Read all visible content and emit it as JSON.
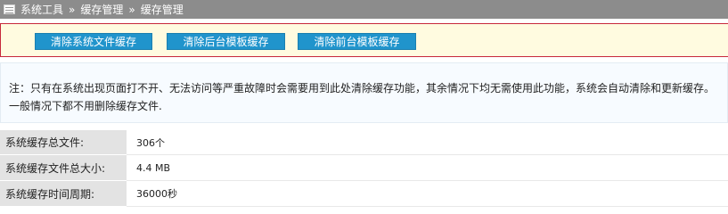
{
  "breadcrumb": {
    "items": [
      "系统工具",
      "缓存管理",
      "缓存管理"
    ],
    "separator": "»"
  },
  "actions": {
    "clear_system_files": "清除系统文件缓存",
    "clear_backend_templates": "清除后台模板缓存",
    "clear_frontend_templates": "清除前台模板缓存"
  },
  "notice": {
    "line1": "注：只有在系统出现页面打不开、无法访问等严重故障时会需要用到此处清除缓存功能，其余情况下均无需使用此功能，系统会自动清除和更新缓存。",
    "line2": "一般情况下都不用删除缓存文件."
  },
  "stats": [
    {
      "label": "系统缓存总文件:",
      "value": "306个"
    },
    {
      "label": "系统缓存文件总大小:",
      "value": "4.4 MB"
    },
    {
      "label": "系统缓存时间周期:",
      "value": "36000秒"
    }
  ],
  "colors": {
    "topbar": "#8c8c8c",
    "button": "#2094cc",
    "panel_border": "#c7283c",
    "panel_bg": "#fffbe0"
  }
}
